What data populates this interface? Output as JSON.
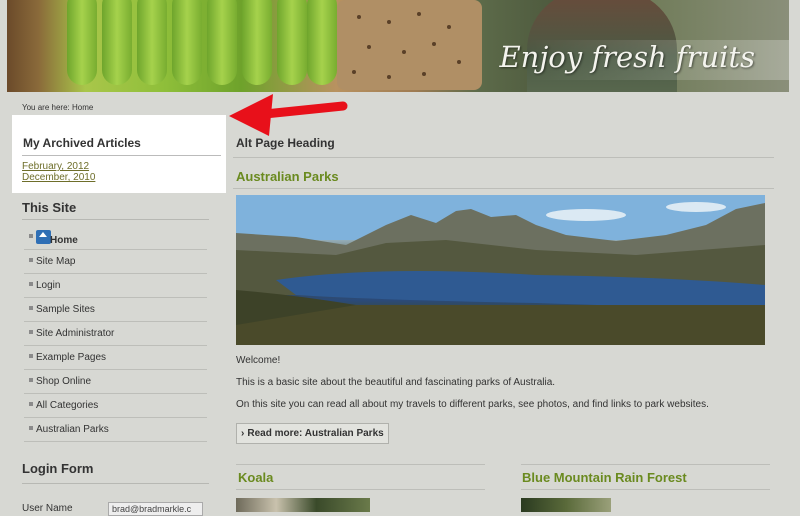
{
  "banner": {
    "slogan": "Enjoy fresh fruits"
  },
  "breadcrumb": "You are here: Home",
  "archived": {
    "title": "My Archived Articles",
    "links": [
      "February, 2012",
      "December, 2010"
    ]
  },
  "this_site": {
    "title": "This Site",
    "items": [
      {
        "label": "Home"
      },
      {
        "label": "Site Map"
      },
      {
        "label": "Login"
      },
      {
        "label": "Sample Sites"
      },
      {
        "label": "Site Administrator"
      },
      {
        "label": "Example Pages"
      },
      {
        "label": "Shop Online"
      },
      {
        "label": "All Categories"
      },
      {
        "label": "Australian Parks"
      }
    ]
  },
  "login": {
    "title": "Login Form",
    "username_label": "User Name",
    "username_value": "brad@bradmarkle.c"
  },
  "main": {
    "page_heading": "Alt Page Heading",
    "article_title": "Australian Parks",
    "welcome": "Welcome!",
    "p1": "This is a basic site about the beautiful and fascinating parks of Australia.",
    "p2": "On this site you can read all about my travels to different parks, see photos, and find links to park websites.",
    "readmore": "Read more: Australian Parks",
    "lower_left_title": "Koala",
    "lower_right_title": "Blue Mountain Rain Forest"
  },
  "colors": {
    "accent_green": "#6a8a1f",
    "annotation_red": "#e8101a",
    "background": "#d7d8d3"
  }
}
